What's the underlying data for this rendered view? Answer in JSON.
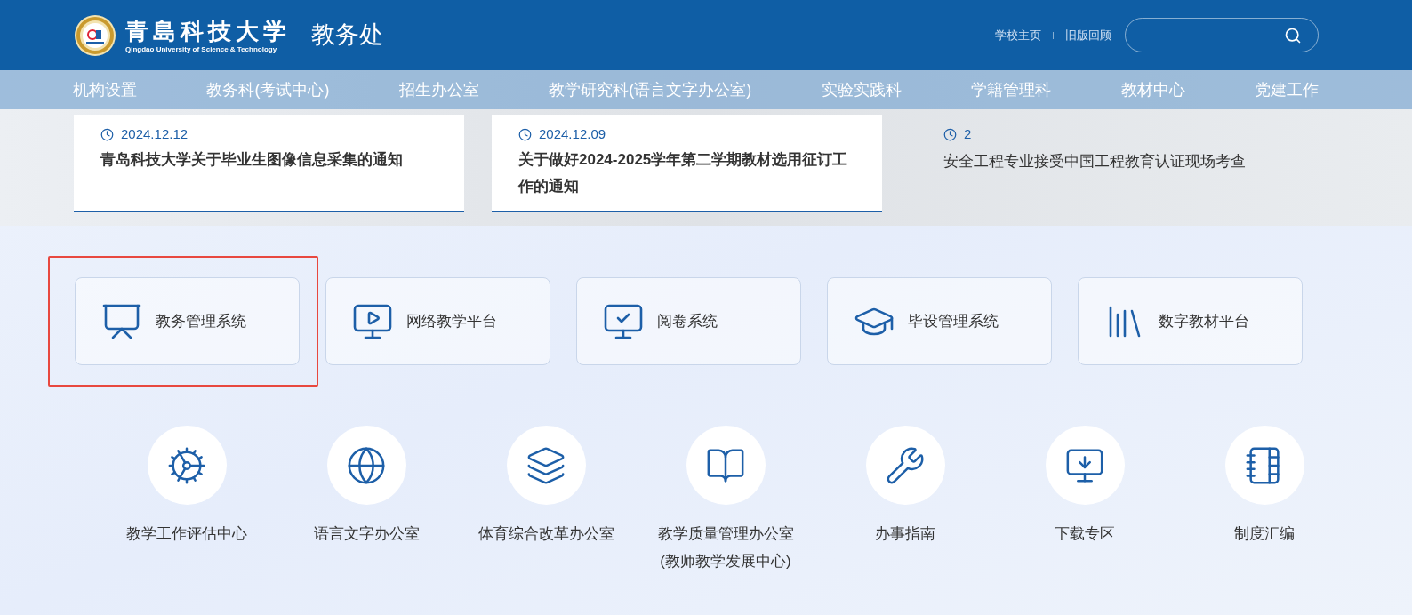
{
  "header": {
    "logo_title": "青島科技大学",
    "logo_subtitle": "Qingdao University of Science & Technology",
    "department": "教务处",
    "links": [
      "学校主页",
      "旧版回顾"
    ]
  },
  "nav": [
    "机构设置",
    "教务科(考试中心)",
    "招生办公室",
    "教学研究科(语言文字办公室)",
    "实验实践科",
    "学籍管理科",
    "教材中心",
    "党建工作"
  ],
  "news": [
    {
      "kind": "card",
      "date": "2024.12.12",
      "title": "青岛科技大学关于毕业生图像信息采集的通知"
    },
    {
      "kind": "card",
      "date": "2024.12.09",
      "title": "关于做好2024-2025学年第二学期教材选用征订工作的通知"
    },
    {
      "kind": "plain",
      "date": "2",
      "title": "安全工程专业接受中国工程教育认证现场考查"
    }
  ],
  "systems": [
    {
      "label": "教务管理系统",
      "selected": true
    },
    {
      "label": "网络教学平台",
      "selected": false
    },
    {
      "label": "阅卷系统",
      "selected": false
    },
    {
      "label": "毕设管理系统",
      "selected": false
    },
    {
      "label": "数字教材平台",
      "selected": false
    }
  ],
  "quick_links": [
    {
      "label": "教学工作评估中心"
    },
    {
      "label": "语言文字办公室"
    },
    {
      "label": "体育综合改革办公室"
    },
    {
      "label": "教学质量管理办公室",
      "note": "(教师教学发展中心)"
    },
    {
      "label": "办事指南"
    },
    {
      "label": "下载专区"
    },
    {
      "label": "制度汇编"
    }
  ]
}
